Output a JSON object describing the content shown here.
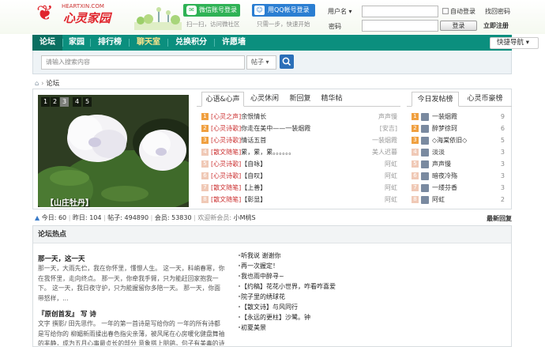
{
  "header": {
    "site_url": "HEARTXIN.COM",
    "site_name": "心灵家园",
    "wechat_btn": "微信账号登录",
    "wechat_sub": "扫一扫，访问微社区",
    "qq_btn": "用QQ帐号登录",
    "qq_sub": "只需一步，快速开始",
    "user_select": "用户名",
    "password_label": "密码",
    "auto_login": "自动登录",
    "find_password": "找回密码",
    "login_btn": "登录",
    "register": "立即注册"
  },
  "nav": {
    "items": [
      "论坛",
      "家园",
      "排行榜",
      "聊天室",
      "兑换积分",
      "许愿墙"
    ],
    "quick_nav": "快捷导航"
  },
  "search": {
    "placeholder": "请输入搜索内容",
    "type": "帖子"
  },
  "breadcrumb": "论坛",
  "slideshow": {
    "numbers": [
      "1",
      "2",
      "3",
      "4",
      "5"
    ],
    "caption": "【山庄牡丹】"
  },
  "mid_tabs": [
    "心语&心声",
    "心灵休闲",
    "新回复",
    "精华帖"
  ],
  "threads": [
    {
      "n": "1",
      "cat": "[心灵之声]",
      "title": "余恨情长",
      "author": "声声慢"
    },
    {
      "n": "2",
      "cat": "[心灵诗歌]",
      "title": "你走在美中——一装烟霞",
      "author": "[安吉]"
    },
    {
      "n": "3",
      "cat": "[心灵诗歌]",
      "title": "情话五首",
      "author": "一装烟霞"
    },
    {
      "n": "4",
      "cat": "[散文随笔]",
      "title": "累，累，累。。。。。。",
      "author": "美人迟暮"
    },
    {
      "n": "5",
      "cat": "[心灵诗歌]",
      "title": "【自咏】",
      "author": "阿虹"
    },
    {
      "n": "6",
      "cat": "[心灵诗歌]",
      "title": "【自叹】",
      "author": "阿虹"
    },
    {
      "n": "7",
      "cat": "[散文随笔]",
      "title": "【上善】",
      "author": "阿虹"
    },
    {
      "n": "8",
      "cat": "[散文随笔]",
      "title": "【彰显】",
      "author": "阿虹"
    }
  ],
  "right_tabs": [
    "今日发帖榜",
    "心灵币豪榜"
  ],
  "posters": [
    {
      "n": "1",
      "name": "一装烟霞",
      "count": "9"
    },
    {
      "n": "2",
      "name": "醉梦徐珂",
      "count": "6"
    },
    {
      "n": "3",
      "name": "◇海棠依旧◇",
      "count": "5"
    },
    {
      "n": "4",
      "name": "淡淡",
      "count": "3"
    },
    {
      "n": "5",
      "name": "声声慢",
      "count": "3"
    },
    {
      "n": "6",
      "name": "暗夜冷殇",
      "count": "3"
    },
    {
      "n": "7",
      "name": "一缕芬香",
      "count": "3"
    },
    {
      "n": "8",
      "name": "阿虹",
      "count": "2"
    }
  ],
  "stats": {
    "today_label": "今日:",
    "today": "60",
    "yesterday_label": "昨日:",
    "yesterday": "104",
    "posts_label": "帖子:",
    "posts": "494890",
    "members_label": "会员:",
    "members": "53830",
    "welcome_label": "欢迎新会员:",
    "newest": "小M桃S",
    "latest_reply": "最新回复"
  },
  "hot": {
    "title": "论坛热点",
    "articles": [
      {
        "title": "那一天，这一天",
        "body": "那一天，大雨先伫，我在你怀里，懂憬人生。 这一天，料峭春寒，你在我怀里，走向终点。 那一天，你牵我手臂，只为能赶回家抱我一下。 这一天，我日夜守护，只为能握留你多陪一天。 那一天，你面带怒样，..."
      },
      {
        "title": "『原创首发』 写 诗",
        "body": "文字 撰影/ 田先思作。 一年的第一首诗是写给你的 一年的所有诗都是写给你的 柳媚新雨揉出春色指尖亲薄，被风尾在心房暖化健盘舞袖的芈静，成为五月心事最贞长的部分 意象搭上朋鸽，句子有美毒的诗 ..."
      }
    ],
    "links": [
      "听我说 谢谢你",
      "再一次握定！",
      "我也雨中醉寻~",
      "【约稿】花花小世界，咋看咋喜爱",
      "院子里的绣球花",
      "【散文诗】与风同行",
      "【永远的更柱】沙鹭。钟",
      "初夏美景"
    ]
  }
}
